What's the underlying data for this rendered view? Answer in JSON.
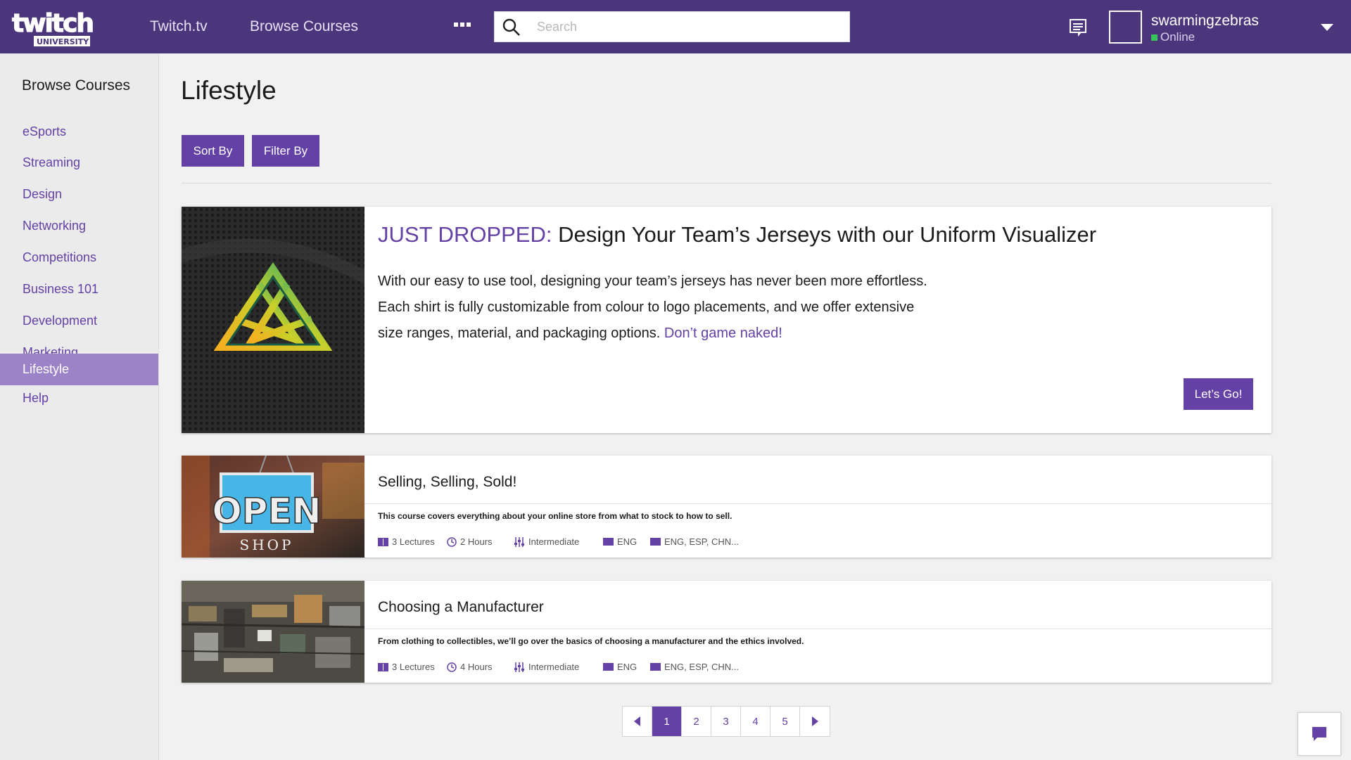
{
  "header": {
    "logo_top": "twitch",
    "logo_bottom": "UNIVERSITY",
    "nav": [
      "Twitch.tv",
      "Browse Courses"
    ],
    "search_placeholder": "Search",
    "username": "swarmingzebras",
    "status": "Online",
    "status_color": "#37c45b",
    "icons": [
      "more-dots-icon",
      "search-icon",
      "messages-icon",
      "caret-down-icon"
    ]
  },
  "sidebar": {
    "title": "Browse Courses",
    "items": [
      "eSports",
      "Streaming",
      "Design",
      "Networking",
      "Competitions",
      "Business 101",
      "Development",
      "Marketing",
      "Lifestyle",
      "Help"
    ],
    "active": "Lifestyle"
  },
  "main": {
    "title": "Lifestyle",
    "sort_label": "Sort By",
    "filter_label": "Filter By"
  },
  "featured": {
    "title_accent": "JUST DROPPED:",
    "title_rest": " Design Your Team’s Jerseys with our Uniform Visualizer",
    "body": "With our easy to use tool, designing your team’s jerseys has never been more effortless. Each shirt is fully customizable from colour to logo placements, and we offer extensive size ranges, material, and packaging options. ",
    "link": "Don’t game naked!",
    "button": "Let’s Go!"
  },
  "courses": [
    {
      "title": "Selling, Selling, Sold!",
      "description": "This course covers everything about your online store from what to stock to how to sell.",
      "lectures": "3 Lectures",
      "hours": "2 Hours",
      "level": "Intermediate",
      "language": "ENG",
      "captions": "ENG, ESP, CHN...",
      "image_text_big": "OPEN",
      "image_text_small": "SHOP"
    },
    {
      "title": "Choosing a Manufacturer",
      "description": "From clothing to collectibles, we’ll go over the basics of choosing a manufacturer and the ethics involved.",
      "lectures": "3 Lectures",
      "hours": "4 Hours",
      "level": "Intermediate",
      "language": "ENG",
      "captions": "ENG, ESP, CHN..."
    }
  ],
  "pagination": {
    "pages": [
      "1",
      "2",
      "3",
      "4",
      "5"
    ],
    "current": "1"
  },
  "colors": {
    "brand": "#6441a4",
    "header": "#4b367c",
    "sidebar_active": "#9c83c8"
  }
}
